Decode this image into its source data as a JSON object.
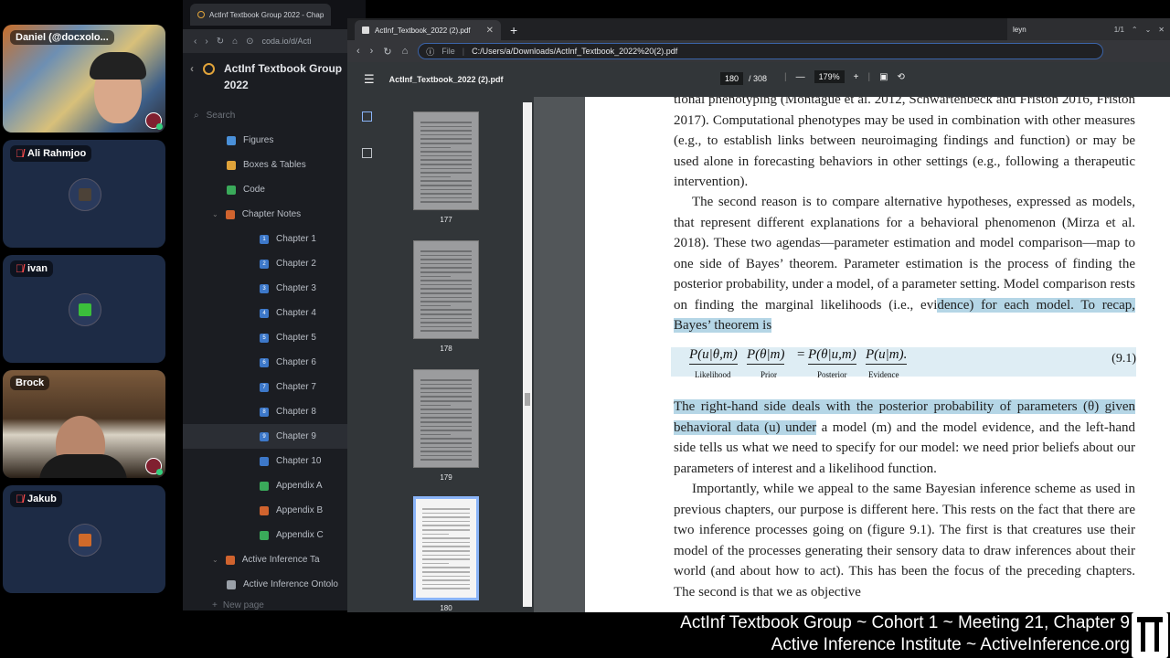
{
  "participants": [
    {
      "name": "Daniel (@docxolo...",
      "muted": false
    },
    {
      "name": "Ali Rahmjoo",
      "muted": true
    },
    {
      "name": "ivan",
      "muted": true
    },
    {
      "name": "Brock",
      "muted": false
    },
    {
      "name": "Jakub",
      "muted": true
    }
  ],
  "coda": {
    "tab_label": "ActInf Textbook Group 2022 - Chap",
    "url": "coda.io/d/Acti",
    "doc_title": "ActInf Textbook Group 2022",
    "search_placeholder": "Search",
    "nav": [
      {
        "label": "Figures",
        "icon": "figures-icon",
        "color": "#4a90d9"
      },
      {
        "label": "Boxes & Tables",
        "icon": "boxes-icon",
        "color": "#e0a33a"
      },
      {
        "label": "Code",
        "icon": "code-icon",
        "color": "#3aaa5a"
      },
      {
        "label": "Chapter Notes",
        "icon": "notes-icon",
        "color": "#d0632e"
      },
      {
        "label": "Chapter 1",
        "icon": "chapter-icon",
        "color": "#3d78c9"
      },
      {
        "label": "Chapter 2",
        "icon": "chapter-icon",
        "color": "#3d78c9"
      },
      {
        "label": "Chapter 3",
        "icon": "chapter-icon",
        "color": "#3d78c9"
      },
      {
        "label": "Chapter 4",
        "icon": "chapter-icon",
        "color": "#3d78c9"
      },
      {
        "label": "Chapter 5",
        "icon": "chapter-icon",
        "color": "#3d78c9"
      },
      {
        "label": "Chapter 6",
        "icon": "chapter-icon",
        "color": "#3d78c9"
      },
      {
        "label": "Chapter 7",
        "icon": "chapter-icon",
        "color": "#3d78c9"
      },
      {
        "label": "Chapter 8",
        "icon": "chapter-icon",
        "color": "#3d78c9"
      },
      {
        "label": "Chapter 9",
        "icon": "chapter-icon",
        "color": "#3d78c9",
        "active": true
      },
      {
        "label": "Chapter 10",
        "icon": "calendar-icon",
        "color": "#3d78c9"
      },
      {
        "label": "Appendix A",
        "icon": "appendix-icon",
        "color": "#3aaa5a"
      },
      {
        "label": "Appendix B",
        "icon": "appendix-icon",
        "color": "#d0632e"
      },
      {
        "label": "Appendix C",
        "icon": "appendix-icon",
        "color": "#3aaa5a"
      },
      {
        "label": "Active Inference Ta",
        "icon": "folder-icon",
        "color": "#d0632e"
      },
      {
        "label": "Active Inference Ontolo",
        "icon": "table-icon",
        "color": "#9aa0a8"
      }
    ],
    "new_page": "New page"
  },
  "pdf": {
    "tab_label": "ActInf_Textbook_2022 (2).pdf",
    "url_scheme": "File",
    "url": "C:/Users/a/Downloads/ActInf_Textbook_2022%20(2).pdf",
    "file_name": "ActInf_Textbook_2022 (2).pdf",
    "current_page": "180",
    "total_pages": "/ 308",
    "zoom": "179%",
    "find_query": "leyn",
    "find_count": "1/1",
    "thumbnails": [
      "177",
      "178",
      "179",
      "180"
    ],
    "selected_page": "180",
    "paragraph_1": "tional phenotyping (Montague et al. 2012, Schwartenbeck and Friston 2016, Friston 2017). Computational phenotypes may be used in combination with other measures (e.g., to establish links between neuroimaging findings and function) or may be used alone in forecasting behaviors in other settings (e.g., following a therapeutic intervention).",
    "paragraph_2_pre": "The second reason is to compare alternative hypotheses, expressed as models, that represent different explanations for a behavioral phenomenon (Mirza et al. 2018). These two agendas—parameter estimation and model comparison—map to one side of Bayes’ theorem. Parameter estimation is the process of finding the posterior probability, under a model, of a parameter setting. Model comparison rests on finding the marginal likelihoods (i.e., evi",
    "paragraph_2_hl": "dence) for each model. To recap, Bayes’ theorem is",
    "equation": {
      "terms": [
        "P(u|θ,m)",
        "P(θ|m)",
        "=",
        "P(θ|u,m)",
        "P(u|m)."
      ],
      "labels": [
        "Likelihood",
        "Prior",
        "Posterior",
        "Evidence"
      ],
      "number": "(9.1)"
    },
    "paragraph_3_hl": "The right-hand side deals with the posterior probability of parameters (θ) given behavioral data (u) under",
    "paragraph_3_post": " a model (m) and the model evidence, and the left-hand side tells us what we need to specify for our model: we need prior beliefs about our parameters of interest and a likelihood function.",
    "paragraph_4": "Importantly, while we appeal to the same Bayesian inference scheme as used in previous chapters, our purpose is different here. This rests on the fact that there are two inference processes going on (figure 9.1). The first is that creatures use their model of the processes generating their sensory data to draw inferences about their world (and about how to act). This has been the focus of the preceding chapters. The second is that we as objective"
  },
  "caption": {
    "line1": "ActInf Textbook Group ~ Cohort 1 ~ Meeting 21, Chapter 9",
    "line2": "Active Inference Institute ~ ActiveInference.org"
  }
}
